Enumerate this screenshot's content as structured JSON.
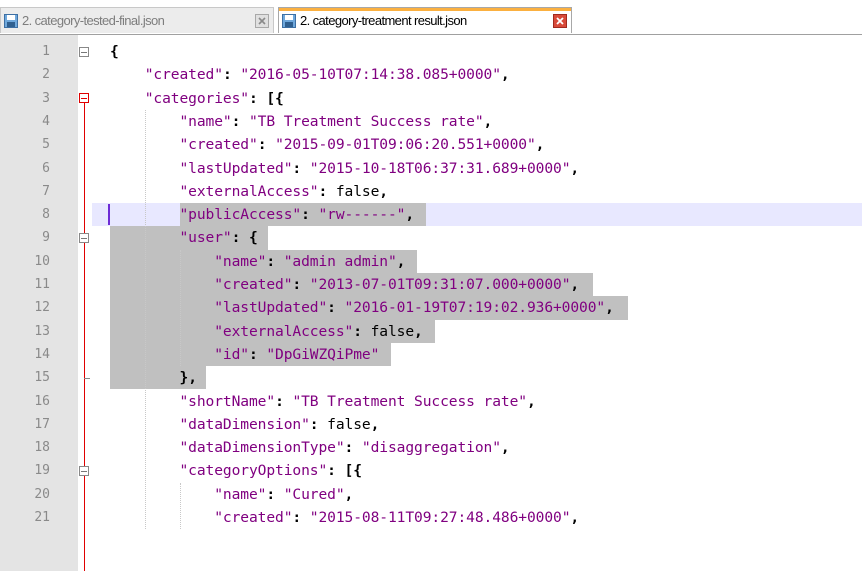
{
  "tabs": [
    {
      "label": "2. category-tested-final.json",
      "active": false
    },
    {
      "label": "2. category-treatment result.json",
      "active": true
    }
  ],
  "colors": {
    "accent": "#fbb040",
    "keyword": "#800080",
    "string": "#800080",
    "selection": "#c0c0c0",
    "fold": "#e00000"
  },
  "icons": [
    "save-icon",
    "close-icon",
    "fold-minus-icon"
  ],
  "lines": [
    {
      "n": "1",
      "text": "{"
    },
    {
      "n": "2",
      "text": "    \"created\": \"2016-05-10T07:14:38.085+0000\","
    },
    {
      "n": "3",
      "text": "    \"categories\": [{"
    },
    {
      "n": "4",
      "text": "        \"name\": \"TB Treatment Success rate\","
    },
    {
      "n": "5",
      "text": "        \"created\": \"2015-09-01T09:06:20.551+0000\","
    },
    {
      "n": "6",
      "text": "        \"lastUpdated\": \"2015-10-18T06:37:31.689+0000\","
    },
    {
      "n": "7",
      "text": "        \"externalAccess\": false,"
    },
    {
      "n": "8",
      "text": "        \"publicAccess\": \"rw------\","
    },
    {
      "n": "9",
      "text": "        \"user\": {"
    },
    {
      "n": "10",
      "text": "            \"name\": \"admin admin\","
    },
    {
      "n": "11",
      "text": "            \"created\": \"2013-07-01T09:31:07.000+0000\","
    },
    {
      "n": "12",
      "text": "            \"lastUpdated\": \"2016-01-19T07:19:02.936+0000\","
    },
    {
      "n": "13",
      "text": "            \"externalAccess\": false,"
    },
    {
      "n": "14",
      "text": "            \"id\": \"DpGiWZQiPme\""
    },
    {
      "n": "15",
      "text": "        },"
    },
    {
      "n": "16",
      "text": "        \"shortName\": \"TB Treatment Success rate\","
    },
    {
      "n": "17",
      "text": "        \"dataDimension\": false,"
    },
    {
      "n": "18",
      "text": "        \"dataDimensionType\": \"disaggregation\","
    },
    {
      "n": "19",
      "text": "        \"categoryOptions\": [{"
    },
    {
      "n": "20",
      "text": "            \"name\": \"Cured\","
    },
    {
      "n": "21",
      "text": "            \"created\": \"2015-08-11T09:27:48.486+0000\","
    }
  ]
}
